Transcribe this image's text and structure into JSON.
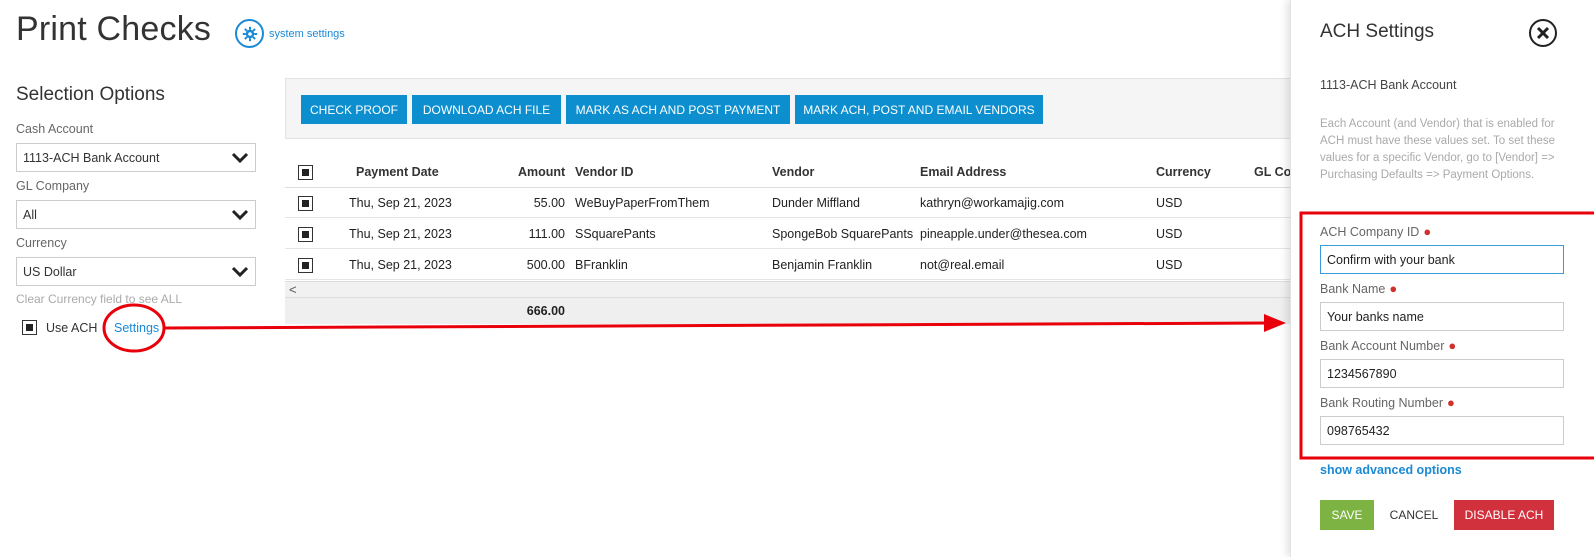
{
  "page": {
    "title": "Print Checks",
    "system_settings_label": "system settings"
  },
  "selection": {
    "title": "Selection Options",
    "cash_account_label": "Cash Account",
    "cash_account_value": "1113-ACH Bank Account",
    "gl_company_label": "GL Company",
    "gl_company_value": "All",
    "currency_label": "Currency",
    "currency_value": "US Dollar",
    "currency_hint": "Clear Currency field to see ALL",
    "use_ach_label": "Use ACH",
    "use_ach_checked": true,
    "settings_link": "Settings"
  },
  "toolbar": {
    "buttons": [
      "CHECK PROOF",
      "DOWNLOAD ACH FILE",
      "MARK AS ACH AND POST PAYMENT",
      "MARK ACH, POST AND EMAIL VENDORS"
    ]
  },
  "grid": {
    "headers": [
      "Payment Date",
      "Amount",
      "Vendor ID",
      "Vendor",
      "Email Address",
      "Currency",
      "GL Cor"
    ],
    "rows": [
      [
        "Thu, Sep 21, 2023",
        "55.00",
        "WeBuyPaperFromThem",
        "Dunder Miffland",
        "kathryn@workamajig.com",
        "USD"
      ],
      [
        "Thu, Sep 21, 2023",
        "111.00",
        "SSquarePants",
        "SpongeBob SquarePants",
        "pineapple.under@thesea.com",
        "USD"
      ],
      [
        "Thu, Sep 21, 2023",
        "500.00",
        "BFranklin",
        "Benjamin Franklin",
        "not@real.email",
        "USD"
      ]
    ],
    "total": "666.00",
    "scroll_left": "<"
  },
  "panel": {
    "title": "ACH Settings",
    "account": "1113-ACH Bank Account",
    "description": "Each Account (and Vendor) that is enabled for ACH must have these values set. To set these values for a specific Vendor, go to [Vendor] => Purchasing Defaults => Payment Options.",
    "fields": [
      {
        "label": "ACH Company ID",
        "value": "Confirm with your bank"
      },
      {
        "label": "Bank Name",
        "value": "Your banks name"
      },
      {
        "label": "Bank Account Number",
        "value": "1234567890"
      },
      {
        "label": "Bank Routing Number",
        "value": "098765432"
      }
    ],
    "required_marker": "●",
    "advanced_link": "show advanced options",
    "save_label": "SAVE",
    "cancel_label": "CANCEL",
    "disable_label": "DISABLE ACH"
  },
  "colors": {
    "accent": "#0d8fcf",
    "link": "#1a8ad6",
    "save": "#7cb342",
    "danger": "#d0313d",
    "annotation": "#e8000b"
  }
}
